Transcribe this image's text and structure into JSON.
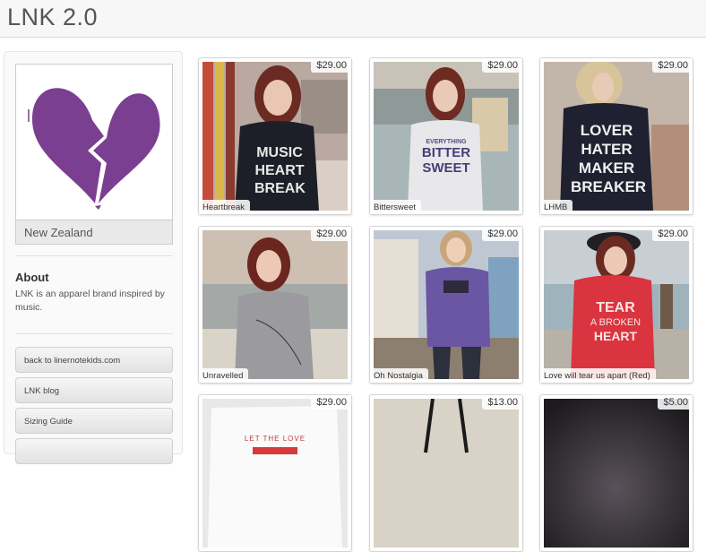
{
  "header": {
    "brand": "LNK 2.0"
  },
  "sidebar": {
    "location": "New Zealand",
    "about_title": "About",
    "about_text": "LNK is an apparel brand inspired by music.",
    "links": [
      "back to linernotekids.com",
      "LNK blog",
      "Sizing Guide"
    ]
  },
  "products": [
    {
      "price": "$29.00",
      "name": "Heartbreak"
    },
    {
      "price": "$29.00",
      "name": "Bittersweet"
    },
    {
      "price": "$29.00",
      "name": "LHMB"
    },
    {
      "price": "$29.00",
      "name": "Unravelled"
    },
    {
      "price": "$29.00",
      "name": "Oh Nostalgia"
    },
    {
      "price": "$29.00",
      "name": "Love will tear us apart (Red)"
    },
    {
      "price": "$29.00",
      "name": ""
    },
    {
      "price": "$13.00",
      "name": ""
    },
    {
      "price": "$5.00",
      "name": ""
    }
  ],
  "shirt_prints": {
    "heartbreak": [
      "MUSIC",
      "HEART",
      "BREAK"
    ],
    "bittersweet": [
      "EVERYTHING",
      "BITTER",
      "SWEET"
    ],
    "lhmb": [
      "LOVER",
      "HATER",
      "MAKER",
      "BREAKER"
    ],
    "love_red": [
      "TEAR",
      "A BROKEN",
      "HEART"
    ],
    "let_love": [
      "LET THE LOVE"
    ]
  },
  "colors": {
    "logo_purple": "#7a3f91"
  }
}
